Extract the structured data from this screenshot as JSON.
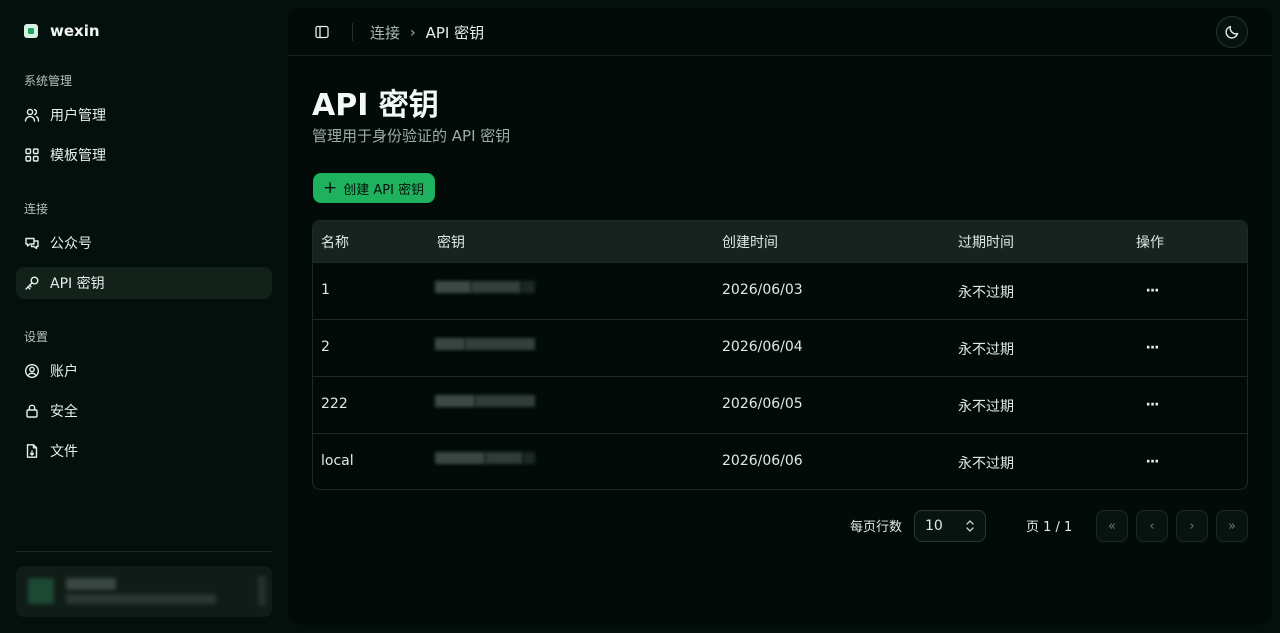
{
  "brand": {
    "name": "wexin"
  },
  "sidebar": {
    "groups": [
      {
        "label": "系统管理",
        "items": [
          {
            "label": "用户管理",
            "icon": "users-icon"
          },
          {
            "label": "模板管理",
            "icon": "grid-icon"
          }
        ]
      },
      {
        "label": "连接",
        "items": [
          {
            "label": "公众号",
            "icon": "chat-icon"
          },
          {
            "label": "API 密钥",
            "icon": "key-icon",
            "active": true
          }
        ]
      },
      {
        "label": "设置",
        "items": [
          {
            "label": "账户",
            "icon": "user-circle-icon"
          },
          {
            "label": "安全",
            "icon": "lock-icon"
          },
          {
            "label": "文件",
            "icon": "file-icon"
          }
        ]
      }
    ]
  },
  "header": {
    "breadcrumb": {
      "parent": "连接",
      "separator": "›",
      "current": "API 密钥"
    }
  },
  "page": {
    "title": "API 密钥",
    "subtitle": "管理用于身份验证的 API 密钥",
    "create_button": "创建 API 密钥"
  },
  "table": {
    "columns": [
      "名称",
      "密钥",
      "创建时间",
      "过期时间",
      "操作"
    ],
    "rows": [
      {
        "name": "1",
        "created": "2026/06/03",
        "expires": "永不过期"
      },
      {
        "name": "2",
        "created": "2026/06/04",
        "expires": "永不过期"
      },
      {
        "name": "222",
        "created": "2026/06/05",
        "expires": "永不过期"
      },
      {
        "name": "local",
        "created": "2026/06/06",
        "expires": "永不过期"
      }
    ],
    "more_label": "···"
  },
  "pagination": {
    "rows_per_page_label": "每页行数",
    "rows_per_page": "10",
    "page_info": "页 1 / 1",
    "first": "«",
    "prev": "‹",
    "next": "›",
    "last": "»"
  },
  "colors": {
    "accent": "#1fb25e",
    "background": "#04100c",
    "panel": "#020b08"
  }
}
